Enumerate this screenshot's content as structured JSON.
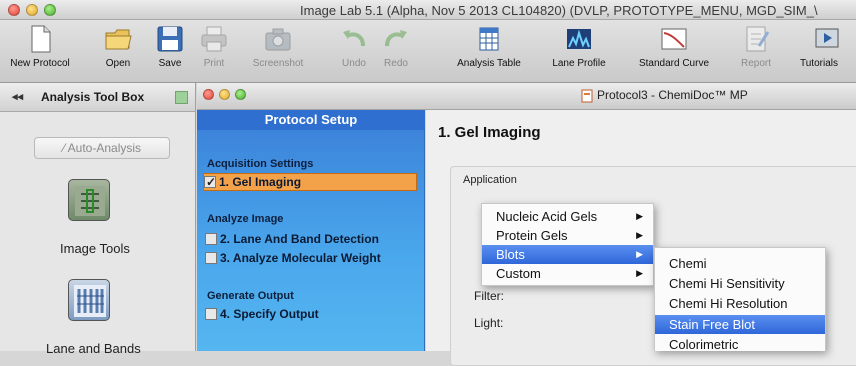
{
  "window": {
    "title": "Image Lab 5.1 (Alpha, Nov  5 2013 CL104820) (DVLP, PROTOTYPE_MENU, MGD_SIM_\\"
  },
  "toolbar": {
    "items": [
      {
        "label": "New Protocol",
        "icon": "new-document-icon",
        "enabled": true
      },
      {
        "label": "Open",
        "icon": "folder-icon",
        "enabled": true
      },
      {
        "label": "Save",
        "icon": "floppy-disk-icon",
        "enabled": true
      },
      {
        "label": "Print",
        "icon": "printer-icon",
        "enabled": false
      },
      {
        "label": "Screenshot",
        "icon": "camera-icon",
        "enabled": false
      },
      {
        "label": "Undo",
        "icon": "undo-icon",
        "enabled": false
      },
      {
        "label": "Redo",
        "icon": "redo-icon",
        "enabled": false
      },
      {
        "label": "Analysis Table",
        "icon": "table-icon",
        "enabled": true
      },
      {
        "label": "Lane Profile",
        "icon": "lane-profile-icon",
        "enabled": true
      },
      {
        "label": "Standard Curve",
        "icon": "standard-curve-icon",
        "enabled": true
      },
      {
        "label": "Report",
        "icon": "report-icon",
        "enabled": false
      },
      {
        "label": "Tutorials",
        "icon": "tutorials-icon",
        "enabled": true
      }
    ]
  },
  "sidebar": {
    "collapse_glyph": "◂◂",
    "title": "Analysis Tool Box",
    "auto_analysis": "Auto-Analysis",
    "tools": [
      {
        "label": "Image Tools",
        "icon": "image-tools-icon"
      },
      {
        "label": "Lane and Bands",
        "icon": "lane-and-bands-icon"
      }
    ]
  },
  "inner_window": {
    "title": "Protocol3 - ChemiDoc™ MP"
  },
  "protocol": {
    "header": "Protocol Setup",
    "sections": [
      {
        "title": "Acquisition Settings",
        "steps": [
          {
            "label": "1. Gel Imaging",
            "checked": true,
            "active": true
          }
        ]
      },
      {
        "title": "Analyze Image",
        "steps": [
          {
            "label": "2. Lane And Band Detection",
            "checked": false,
            "active": false
          },
          {
            "label": "3. Analyze Molecular Weight",
            "checked": false,
            "active": false
          }
        ]
      },
      {
        "title": "Generate Output",
        "steps": [
          {
            "label": "4. Specify Output",
            "checked": false,
            "active": false
          }
        ]
      }
    ]
  },
  "main": {
    "title": "1. Gel Imaging",
    "application_label": "Application",
    "filter_label": "Filter:",
    "light_label": "Light:"
  },
  "menu": {
    "items": [
      {
        "label": "Nucleic Acid Gels",
        "submenu": true
      },
      {
        "label": "Protein Gels",
        "submenu": true
      },
      {
        "label": "Blots",
        "submenu": true,
        "highlighted": true
      },
      {
        "label": "Custom",
        "submenu": true
      }
    ],
    "submenu_items": [
      {
        "label": "Chemi"
      },
      {
        "label": "Chemi Hi Sensitivity"
      },
      {
        "label": "Chemi Hi Resolution"
      },
      {
        "label": "Stain Free Blot",
        "highlighted": true
      },
      {
        "label": "Colorimetric"
      }
    ]
  },
  "colors": {
    "protocol_panel": "#4aa7ec",
    "active_step": "#f4a24a",
    "menu_highlight": "#2f67d9"
  }
}
